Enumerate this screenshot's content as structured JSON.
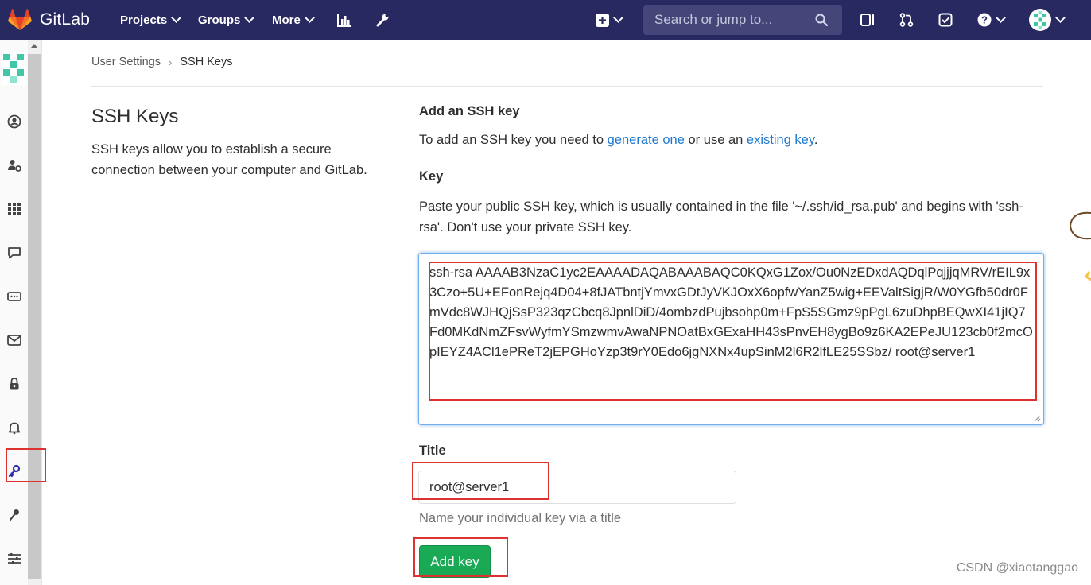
{
  "navbar": {
    "brand": "GitLab",
    "menus": [
      {
        "label": "Projects"
      },
      {
        "label": "Groups"
      },
      {
        "label": "More"
      }
    ],
    "search_placeholder": "Search or jump to...",
    "icons": [
      "plus-square-icon",
      "todo-icon",
      "merge-request-icon",
      "issues-icon",
      "help-icon",
      "avatar"
    ]
  },
  "sidebar": {
    "items": [
      {
        "icon": "avatar"
      },
      {
        "icon": "profile-icon"
      },
      {
        "icon": "account-settings-icon"
      },
      {
        "icon": "applications-icon"
      },
      {
        "icon": "chat-icon"
      },
      {
        "icon": "access-tokens-icon"
      },
      {
        "icon": "emails-icon"
      },
      {
        "icon": "password-lock-icon"
      },
      {
        "icon": "notifications-bell-icon"
      },
      {
        "icon": "ssh-key-icon",
        "active": true
      },
      {
        "icon": "gpg-key-icon"
      },
      {
        "icon": "preferences-icon"
      }
    ]
  },
  "breadcrumb": {
    "parent": "User Settings",
    "current": "SSH Keys"
  },
  "left_panel": {
    "title": "SSH Keys",
    "description": "SSH keys allow you to establish a secure connection between your computer and GitLab."
  },
  "form": {
    "heading": "Add an SSH key",
    "intro_prefix": "To add an SSH key you need to ",
    "intro_link1": "generate one",
    "intro_middle": " or use an ",
    "intro_link2": "existing key",
    "intro_suffix": ".",
    "key_label": "Key",
    "key_help": "Paste your public SSH key, which is usually contained in the file '~/.ssh/id_rsa.pub' and begins with 'ssh-rsa'. Don't use your private SSH key.",
    "key_value": "ssh-rsa AAAAB3NzaC1yc2EAAAADAQABAAABAQC0KQxG1Zox/Ou0NzEDxdAQDqlPqjjjqMRV/rEIL9x3Czo+5U+EFonRejq4D04+8fJATbntjYmvxGDtJyVKJOxX6opfwYanZ5wig+EEValtSigjR/W0YGfb50dr0FmVdc8WJHQjSsP323qzCbcq8JpnlDiD/4ombzdPujbsohp0m+FpS5SGmz9pPgL6zuDhpBEQwXI41jIQ7Fd0MKdNmZFsvWyfmYSmzwmvAwaNPNOatBxGExaHH43sPnvEH8ygBo9z6KA2EPeJU123cb0f2mcOpIEYZ4ACl1ePReT2jEPGHoYzp3t9rY0Edo6jgNXNx4upSinM2l6R2lfLE25SSbz/ root@server1",
    "title_label": "Title",
    "title_value": "root@server1",
    "title_hint": "Name your individual key via a title",
    "submit_label": "Add key"
  },
  "watermark": "CSDN @xiaotanggao",
  "colors": {
    "navbar": "#292961",
    "link": "#1f78d1",
    "button": "#1aaa55",
    "annotation": "#e03131"
  }
}
